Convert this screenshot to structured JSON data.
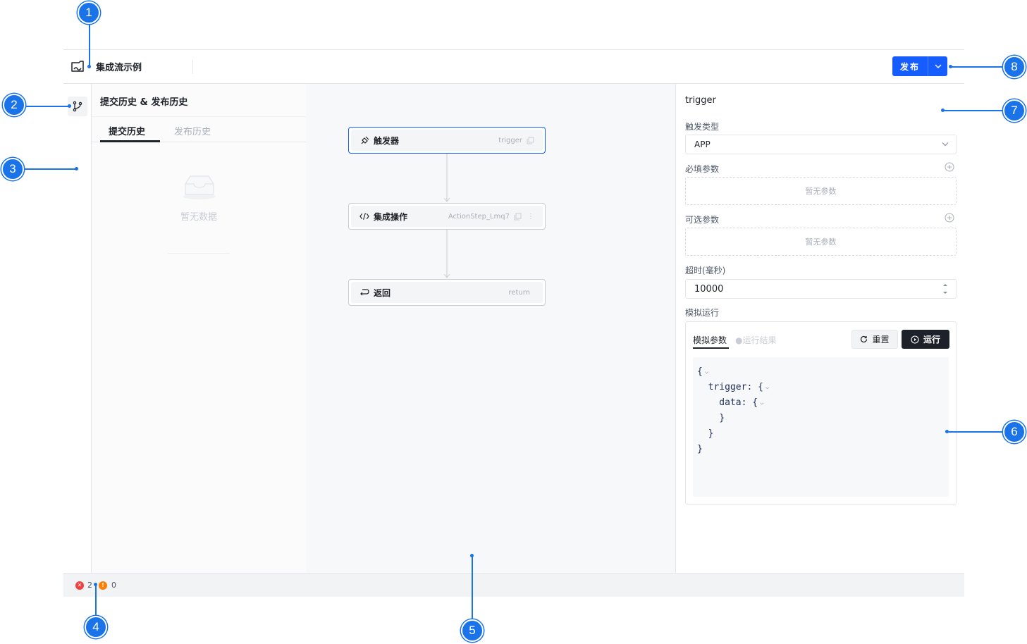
{
  "header": {
    "app_title": "集成流示例",
    "publish_label": "发布"
  },
  "history": {
    "title": "提交历史 & 发布历史",
    "tabs": [
      {
        "label": "提交历史",
        "active": true
      },
      {
        "label": "发布历史",
        "active": false
      }
    ],
    "empty_text": "暂无数据"
  },
  "canvas": {
    "nodes": [
      {
        "label": "触发器",
        "id": "trigger",
        "icon": "trigger-icon",
        "selected": true
      },
      {
        "label": "集成操作",
        "id": "ActionStep_Lmq7",
        "icon": "code-icon",
        "selected": false
      },
      {
        "label": "返回",
        "id": "return",
        "icon": "return-icon",
        "selected": false
      }
    ]
  },
  "panel": {
    "title": "trigger",
    "trigger_type_label": "触发类型",
    "trigger_type_value": "APP",
    "required_params_label": "必填参数",
    "required_params_empty": "暂无参数",
    "optional_params_label": "可选参数",
    "optional_params_empty": "暂无参数",
    "timeout_label": "超时(毫秒)",
    "timeout_value": "10000",
    "simulate_label": "模拟运行",
    "sim_tabs": [
      {
        "label": "模拟参数",
        "active": true
      },
      {
        "label": "●运行结果",
        "active": false
      }
    ],
    "reset_label": "重置",
    "run_label": "运行",
    "code_lines": [
      "{",
      "  trigger: {",
      "    data: {",
      "    }",
      "  }",
      "}"
    ]
  },
  "status": {
    "errors": "2",
    "warnings": "0"
  },
  "callouts": [
    "1",
    "2",
    "3",
    "4",
    "5",
    "6",
    "7",
    "8"
  ],
  "colors": {
    "accent": "#165dff",
    "callout": "#1a73e8",
    "error": "#f53f3f",
    "warning": "#ff7d00"
  }
}
